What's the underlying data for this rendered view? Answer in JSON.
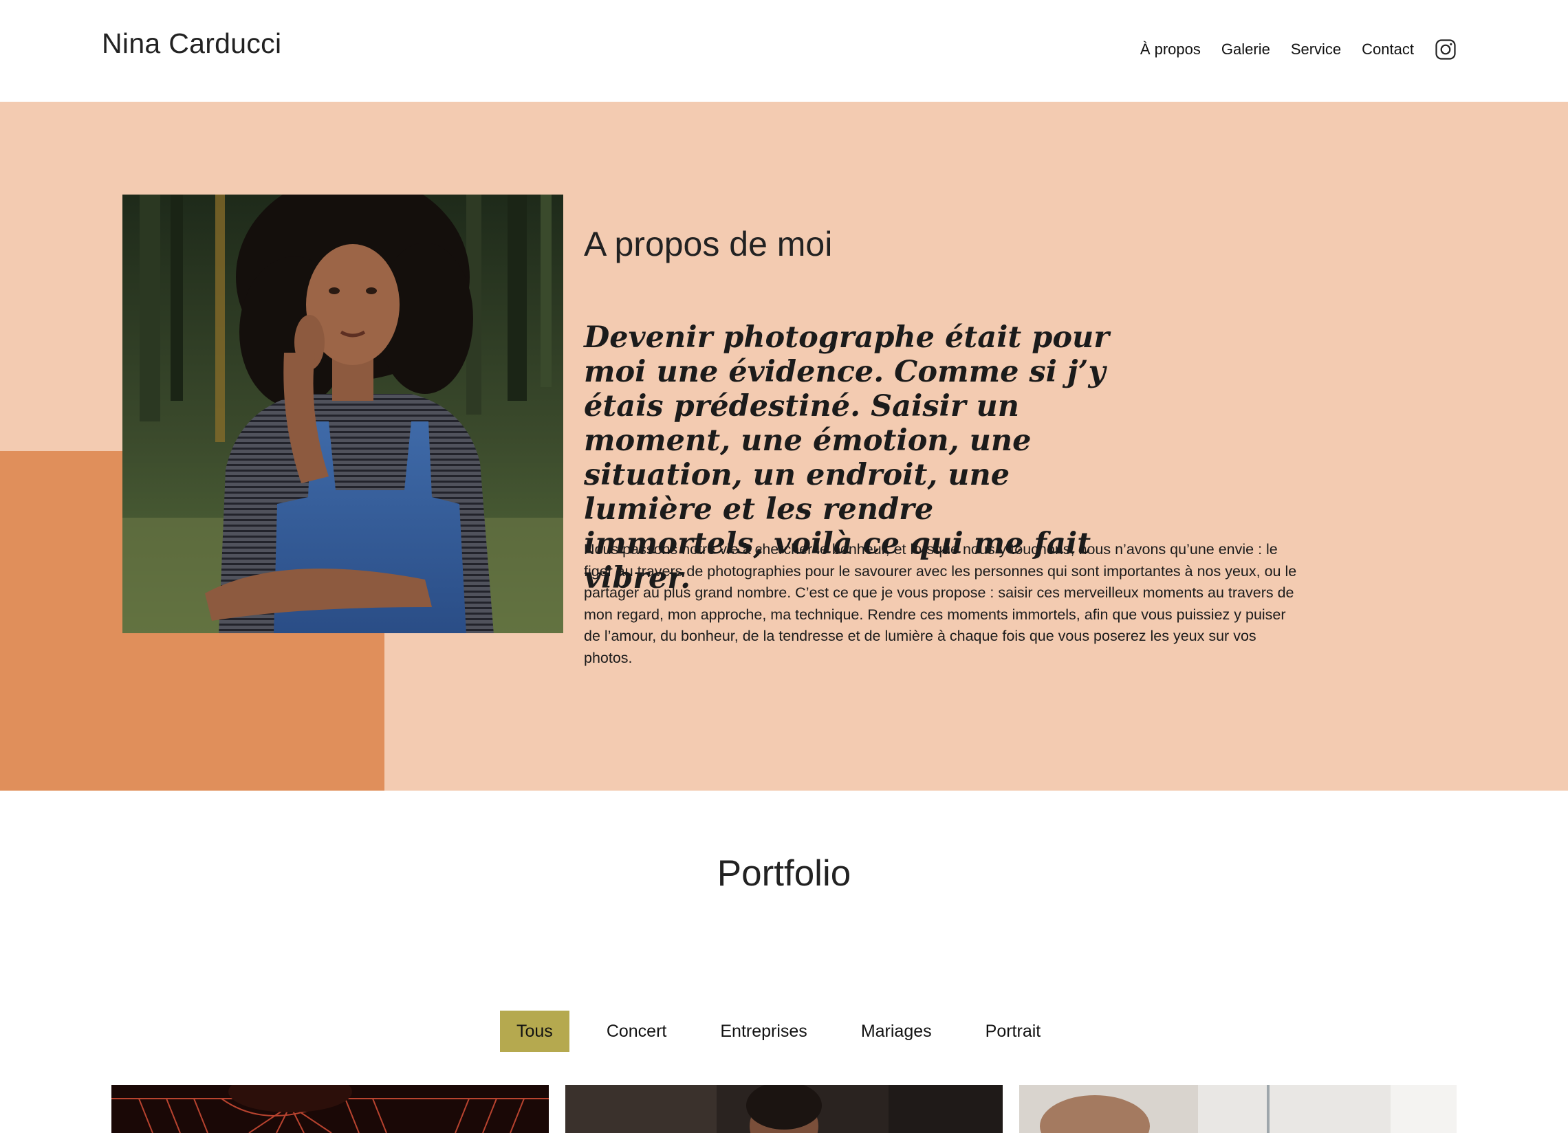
{
  "header": {
    "brand": "Nina Carducci",
    "nav": [
      "À propos",
      "Galerie",
      "Service",
      "Contact"
    ],
    "instagram_icon": "instagram-icon"
  },
  "about": {
    "title": "A propos de moi",
    "quote": "Devenir photographe était pour moi une évidence. Comme si j’y étais prédestiné. Saisir un moment, une émotion, une situation, un endroit, une lumière et les rendre immortels, voilà ce qui me fait vibrer.",
    "text": "Nous passons notre vie à chercher le bonheur, et lorsque nous y touchons, nous n’avons qu’une envie : le figer au travers de photographies pour le savourer avec les personnes qui sont importantes à nos yeux, ou le partager au plus grand nombre. C’est ce que je vous propose : saisir ces merveilleux moments au travers de mon regard, mon approche, ma technique. Rendre ces moments immortels, afin que vous puissiez y puiser de l’amour, du bonheur, de la tendresse et de lumière à chaque fois que vous poserez les yeux sur vos photos."
  },
  "portfolio": {
    "title": "Portfolio",
    "filters": [
      "Tous",
      "Concert",
      "Entreprises",
      "Mariages",
      "Portrait"
    ],
    "active_filter": "Tous"
  },
  "colors": {
    "about_bg": "#f3cbb1",
    "accent_block": "#e08f5b",
    "active_filter": "#b5a94f"
  }
}
